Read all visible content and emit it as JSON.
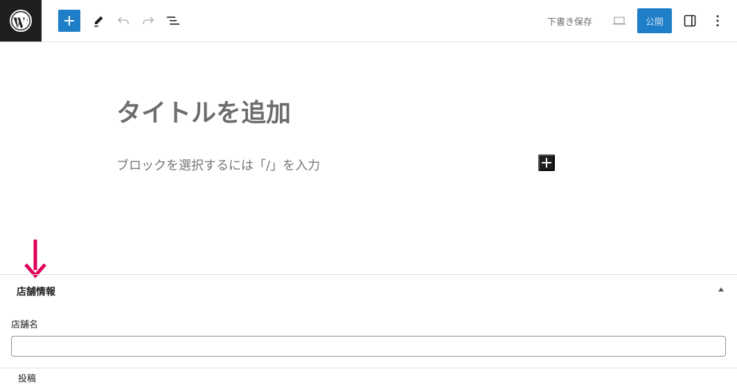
{
  "toolbar": {
    "logo_icon": "wordpress-logo-icon",
    "add_block_icon": "plus-icon",
    "tools_icon": "pencil-icon",
    "undo_icon": "undo-icon",
    "redo_icon": "redo-icon",
    "outline_icon": "list-view-icon",
    "save_draft_label": "下書き保存",
    "preview_icon": "laptop-icon",
    "publish_label": "公開",
    "settings_icon": "sidebar-panel-icon",
    "options_icon": "vertical-ellipsis-icon",
    "accent_color": "#1e7ec8"
  },
  "editor": {
    "title_placeholder": "タイトルを追加",
    "block_placeholder": "ブロックを選択するには「/」を入力",
    "inline_add_icon": "plus-icon"
  },
  "annotation": {
    "arrow_icon": "arrow-down-icon",
    "color": "#e0005a"
  },
  "metabox": {
    "title": "店舗情報",
    "toggle_icon": "triangle-up-icon",
    "field_label": "店舗名",
    "field_value": ""
  },
  "footer": {
    "breadcrumb": "投稿"
  }
}
